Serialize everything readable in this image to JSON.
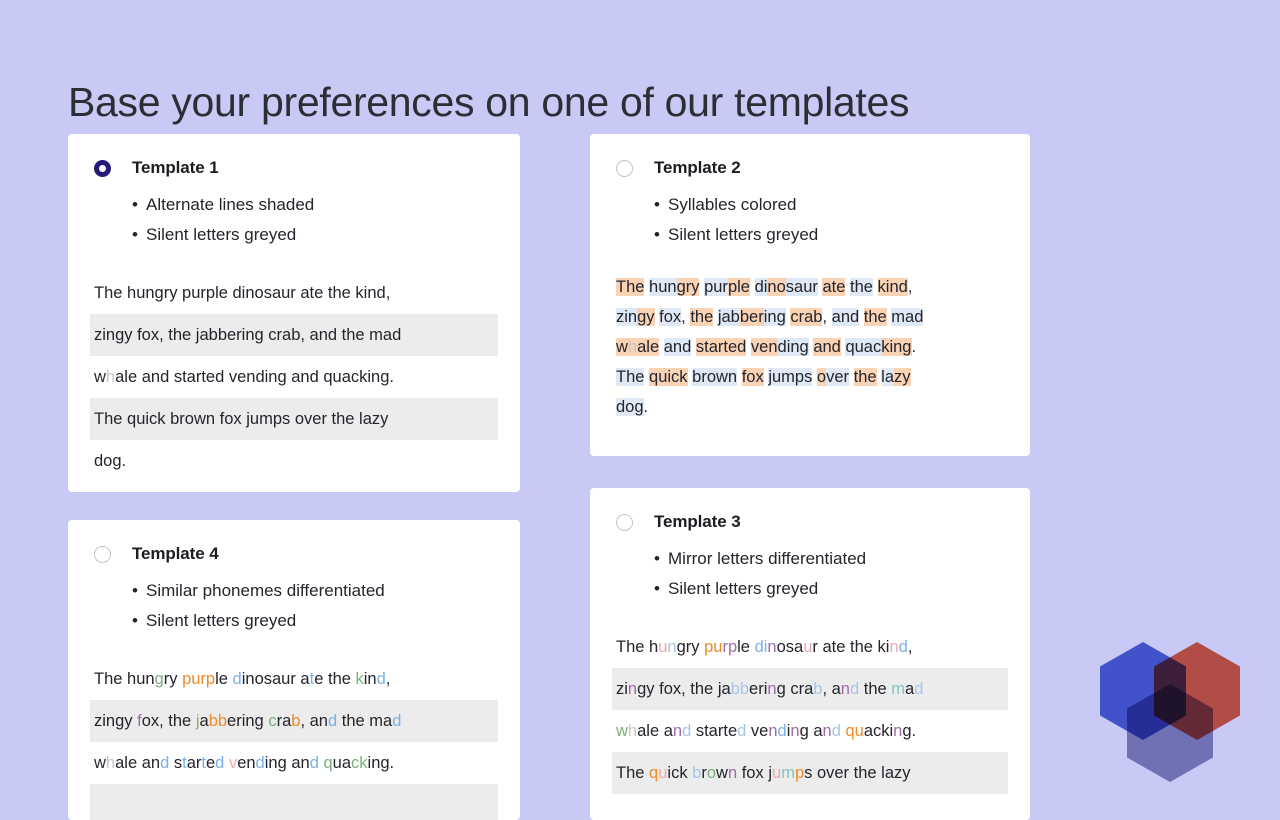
{
  "page": {
    "title": "Base your preferences on one of our templates",
    "background_color": "#c9c9f5"
  },
  "colors": {
    "accent_radio": "#251a7a",
    "line_shade": "#ececec",
    "silent_letter": "#c6c6cc",
    "syllable_a": "#fad3b4",
    "syllable_b": "#dfe8f5",
    "logo_blue": "#5468d4",
    "logo_red": "#e2604a",
    "logo_bottom": "#8e8ebd"
  },
  "sample_text": "The hungry purple dinosaur ate the kind, zingy fox, the jabbering crab, and the mad whale and started vending and quacking. The quick brown fox jumps over the lazy dog.",
  "templates": [
    {
      "id": "template-1",
      "label": "Template 1",
      "selected": true,
      "features": [
        "Alternate lines shaded",
        "Silent letters greyed"
      ],
      "lines": [
        "The hungry purple dinosaur ate the kind,",
        "zingy fox, the jabbering crab, and the mad",
        "whale and started vending and quacking.",
        "The quick brown fox jumps over the lazy",
        "dog."
      ],
      "shaded_lines": [
        1,
        3
      ],
      "silent_letters": [
        "h in whale"
      ]
    },
    {
      "id": "template-2",
      "label": "Template 2",
      "selected": false,
      "features": [
        "Syllables colored",
        "Silent letters greyed"
      ],
      "lines": [
        "The hungry purple dinosaur ate the kind,",
        "zingy fox, the jabbering crab, and the mad",
        "whale and started vending and quacking.",
        "The quick brown fox jumps over the lazy",
        "dog."
      ],
      "syllable_segments": [
        [
          [
            "The",
            "A"
          ],
          [
            " ",
            "-"
          ],
          [
            "hun",
            "B"
          ],
          [
            "gry",
            "A"
          ],
          [
            " ",
            "-"
          ],
          [
            "pur",
            "B"
          ],
          [
            "ple",
            "A"
          ],
          [
            " ",
            "-"
          ],
          [
            "di",
            "B"
          ],
          [
            "no",
            "A"
          ],
          [
            "saur",
            "B"
          ],
          [
            " ",
            "-"
          ],
          [
            "ate",
            "A"
          ],
          [
            " ",
            "-"
          ],
          [
            "the",
            "B"
          ],
          [
            " ",
            "-"
          ],
          [
            "kind",
            "A"
          ],
          [
            ",",
            "-"
          ]
        ],
        [
          [
            "zin",
            "B"
          ],
          [
            "gy",
            "A"
          ],
          [
            " ",
            "-"
          ],
          [
            "fox",
            "B"
          ],
          [
            ", ",
            "-"
          ],
          [
            "the",
            "A"
          ],
          [
            " ",
            "-"
          ],
          [
            "jab",
            "B"
          ],
          [
            "ber",
            "A"
          ],
          [
            "ring",
            "B"
          ],
          [
            " ",
            "-"
          ],
          [
            "crab",
            "A"
          ],
          [
            ", ",
            "-"
          ],
          [
            "and",
            "B"
          ],
          [
            " ",
            "-"
          ],
          [
            "the",
            "A"
          ],
          [
            " ",
            "-"
          ],
          [
            "mad",
            "B"
          ]
        ],
        [
          [
            "whale",
            "A"
          ],
          [
            " ",
            "-"
          ],
          [
            "and",
            "B"
          ],
          [
            " ",
            "-"
          ],
          [
            "started",
            "A"
          ],
          [
            " ",
            "-"
          ],
          [
            "ven",
            "A"
          ],
          [
            "ding",
            "B"
          ],
          [
            " ",
            "-"
          ],
          [
            "and",
            "A"
          ],
          [
            " ",
            "-"
          ],
          [
            "quac",
            "B"
          ],
          [
            "king",
            "A"
          ],
          [
            ".",
            "-"
          ]
        ],
        [
          [
            "The",
            "B"
          ],
          [
            " ",
            "-"
          ],
          [
            "quick",
            "A"
          ],
          [
            " ",
            "-"
          ],
          [
            "brown",
            "B"
          ],
          [
            " ",
            "-"
          ],
          [
            "fox",
            "A"
          ],
          [
            " ",
            "-"
          ],
          [
            "jumps",
            "B"
          ],
          [
            " ",
            "-"
          ],
          [
            "o",
            "A"
          ],
          [
            "ver",
            "B"
          ],
          [
            " ",
            "-"
          ],
          [
            "the",
            "A"
          ],
          [
            " ",
            "-"
          ],
          [
            "la",
            "B"
          ],
          [
            "zy",
            "A"
          ]
        ],
        [
          [
            "dog",
            "B"
          ],
          [
            ".",
            "-"
          ]
        ]
      ],
      "silent_letters": [
        "h in whale"
      ]
    },
    {
      "id": "template-3",
      "label": "Template 3",
      "selected": false,
      "features": [
        "Mirror letters differentiated",
        "Silent letters greyed"
      ],
      "lines": [
        "The hungry purple dinosaur ate the kind,",
        "zingy fox, the jabbering crab, and the mad",
        "whale and started vending and quacking.",
        "The quick brown fox jumps over the lazy"
      ],
      "shaded_lines": [
        1,
        3
      ],
      "mirror_letters": [
        "b",
        "d",
        "p",
        "q",
        "u",
        "n",
        "i",
        "m",
        "w"
      ]
    },
    {
      "id": "template-4",
      "label": "Template 4",
      "selected": false,
      "features": [
        "Similar phonemes differentiated",
        "Silent letters greyed"
      ],
      "lines": [
        "The hungry purple dinosaur ate the kind,",
        "zingy fox, the jabbering crab, and the mad",
        "whale and started vending and quacking."
      ],
      "shaded_lines": [
        1
      ],
      "silent_letters": [
        "h in whale"
      ]
    }
  ],
  "logo": {
    "name": "three-hexagon-logo",
    "shapes": [
      "hexagon-blue",
      "hexagon-red",
      "hexagon-bottom"
    ]
  }
}
